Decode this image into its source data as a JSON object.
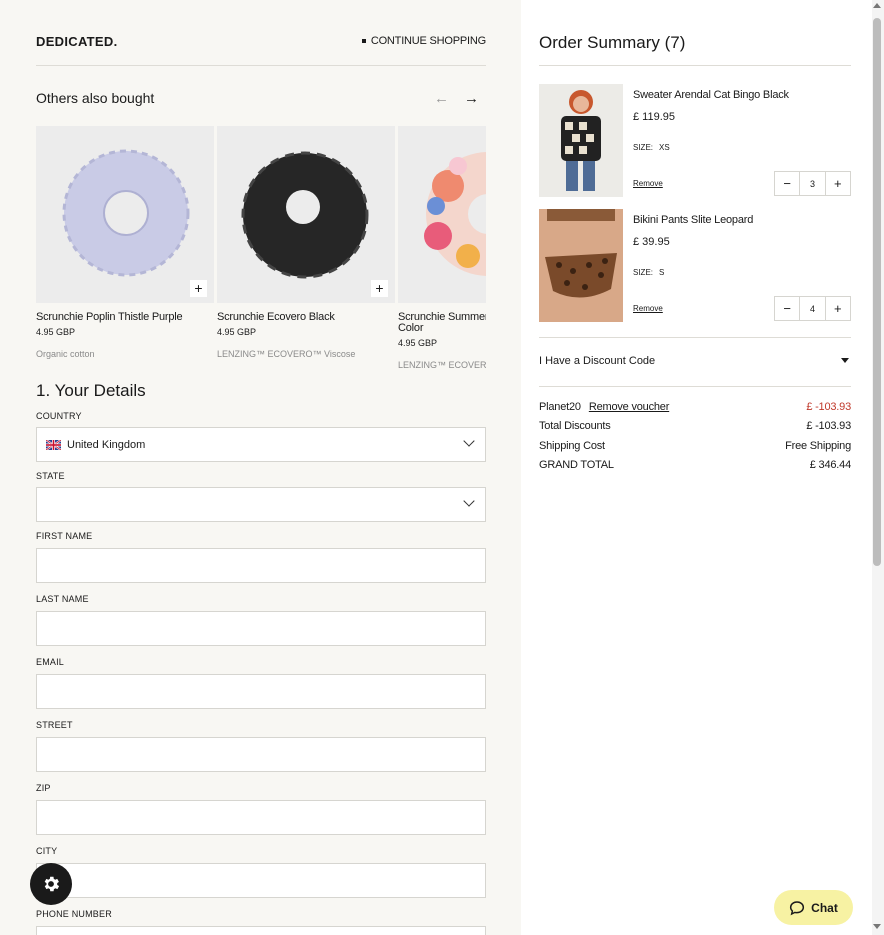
{
  "header": {
    "logo": "DEDICATED.",
    "continue_label": "CONTINUE SHOPPING"
  },
  "others": {
    "title": "Others also bought",
    "products": [
      {
        "name": "Scrunchie Poplin Thistle Purple",
        "price": "4.95 GBP",
        "material": "Organic cotton"
      },
      {
        "name": "Scrunchie Ecovero Black",
        "price": "4.95 GBP",
        "material": "LENZING™ ECOVERO™ Viscose"
      },
      {
        "name": "Scrunchie Summer Color",
        "price": "4.95 GBP",
        "material": "LENZING™ ECOVERO™ Viscose"
      }
    ]
  },
  "details": {
    "title": "1. Your Details",
    "country_label": "COUNTRY",
    "country_value": "United Kingdom",
    "state_label": "STATE",
    "first_name_label": "FIRST NAME",
    "last_name_label": "LAST NAME",
    "email_label": "EMAIL",
    "street_label": "STREET",
    "zip_label": "ZIP",
    "city_label": "CITY",
    "phone_label": "PHONE NUMBER"
  },
  "summary": {
    "title": "Order Summary (7)",
    "items": [
      {
        "name": "Sweater Arendal Cat Bingo Black",
        "price": "£ 119.95",
        "size_label": "SIZE:",
        "size": "XS",
        "remove": "Remove",
        "qty": "3"
      },
      {
        "name": "Bikini Pants Slite Leopard",
        "price": "£ 39.95",
        "size_label": "SIZE:",
        "size": "S",
        "remove": "Remove",
        "qty": "4"
      }
    ],
    "discount_label": "I Have a Discount Code",
    "voucher_name": "Planet20",
    "remove_voucher": "Remove voucher",
    "voucher_value": "£ -103.93",
    "total_discounts_label": "Total Discounts",
    "total_discounts_value": "£ -103.93",
    "shipping_label": "Shipping Cost",
    "shipping_value": "Free Shipping",
    "grand_total_label": "GRAND TOTAL",
    "grand_total_value": "£ 346.44"
  },
  "chat": {
    "label": "Chat"
  },
  "colors": {
    "accent_red": "#c0392b",
    "chat_bg": "#f7f2a3",
    "panel_bg": "#f8f7f3"
  }
}
